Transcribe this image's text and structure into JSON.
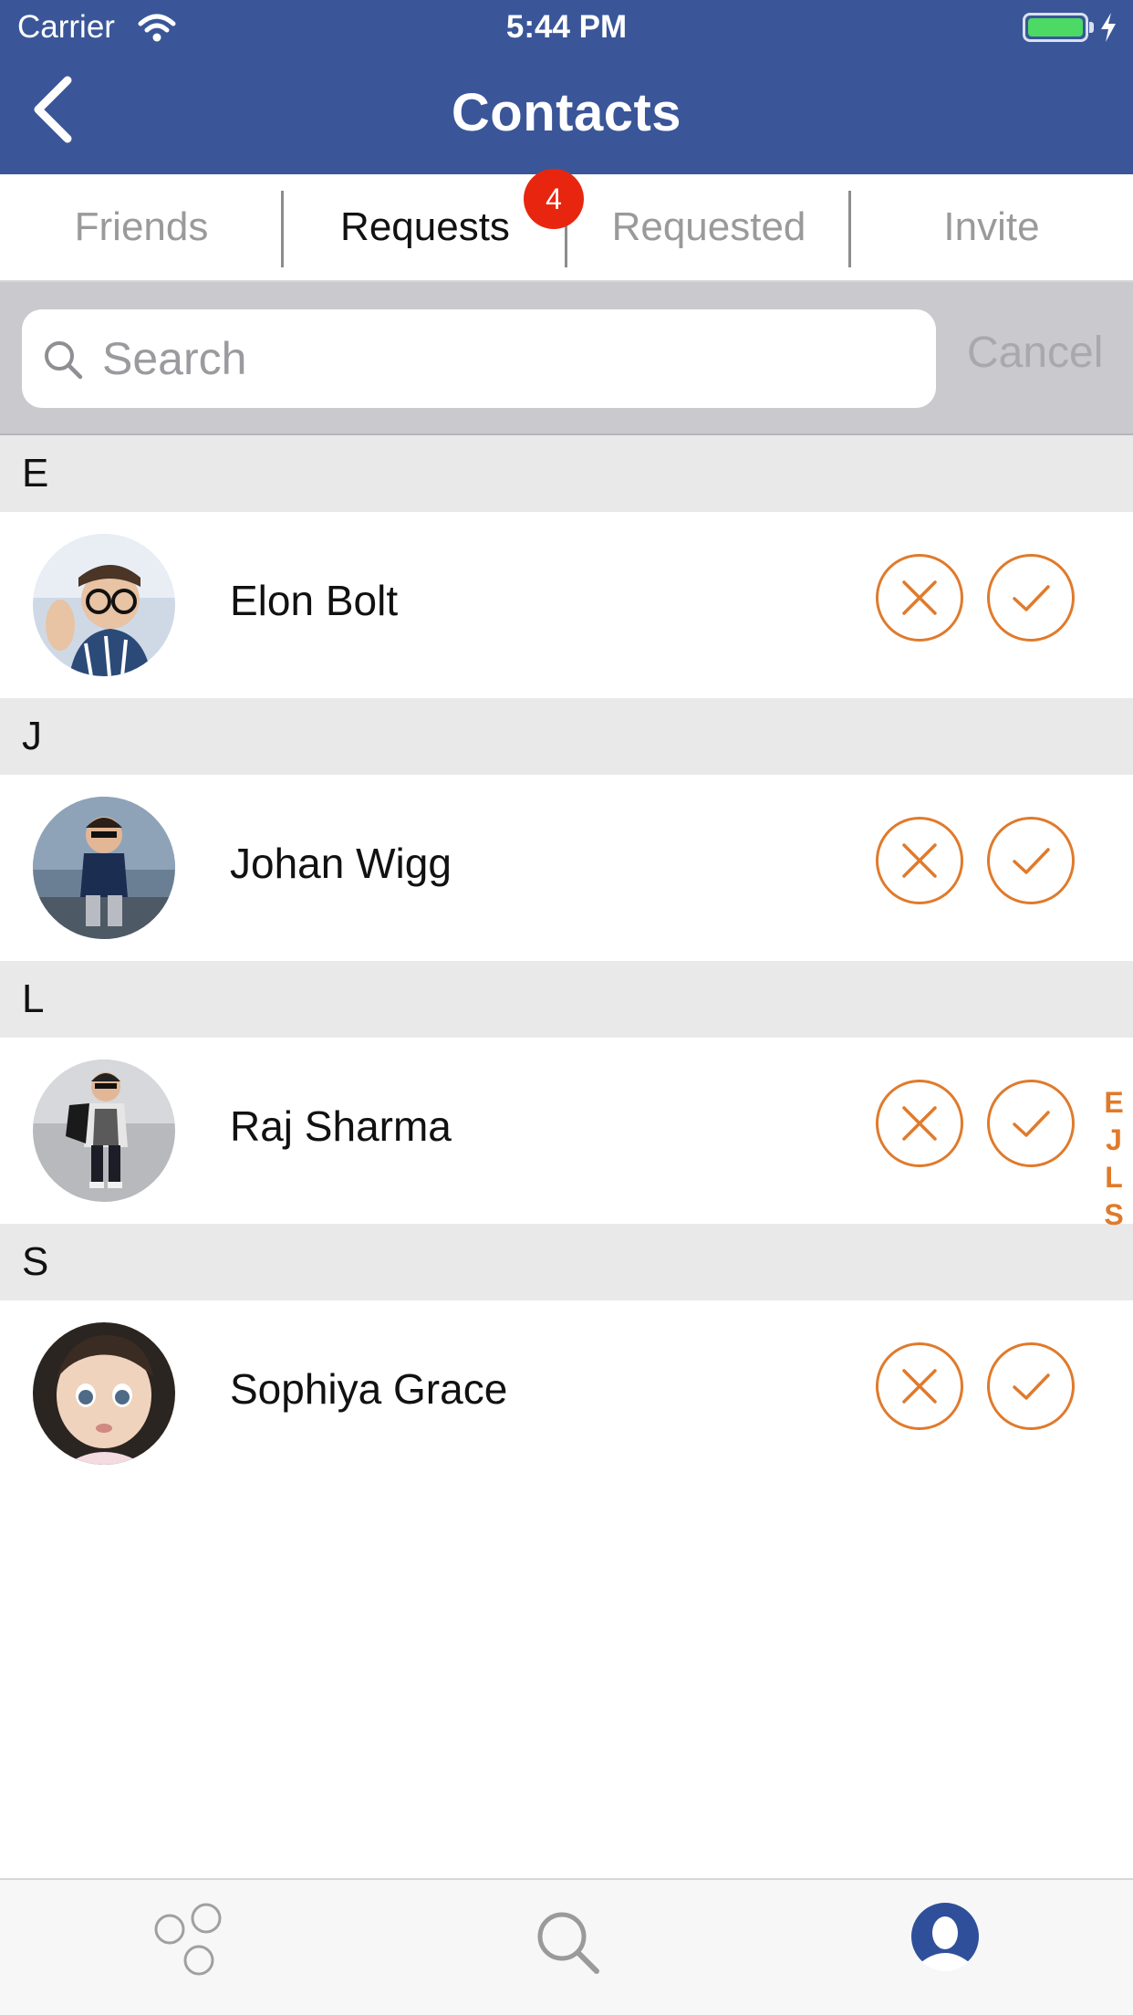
{
  "status": {
    "carrier": "Carrier",
    "time": "5:44 PM"
  },
  "nav": {
    "title": "Contacts"
  },
  "tabs": [
    {
      "label": "Friends",
      "active": false
    },
    {
      "label": "Requests",
      "active": true
    },
    {
      "label": "Requested",
      "active": false
    },
    {
      "label": "Invite",
      "active": false
    }
  ],
  "requests_badge": "4",
  "search": {
    "placeholder": "Search",
    "value": "",
    "cancel_label": "Cancel"
  },
  "sections": [
    {
      "letter": "E",
      "contacts": [
        {
          "name": "Elon Bolt"
        }
      ]
    },
    {
      "letter": "J",
      "contacts": [
        {
          "name": "Johan Wigg"
        }
      ]
    },
    {
      "letter": "L",
      "contacts": [
        {
          "name": "Raj Sharma"
        }
      ]
    },
    {
      "letter": "S",
      "contacts": [
        {
          "name": "Sophiya Grace"
        }
      ]
    }
  ],
  "index_letters": [
    "E",
    "J",
    "L",
    "S"
  ],
  "icons": {
    "decline": "x-icon",
    "accept": "check-icon",
    "tabbar": [
      "bubbles-icon",
      "search-icon",
      "profile-icon"
    ]
  },
  "colors": {
    "nav_bg": "#3a5699",
    "accent": "#e07a2b",
    "badge": "#e8260f"
  }
}
